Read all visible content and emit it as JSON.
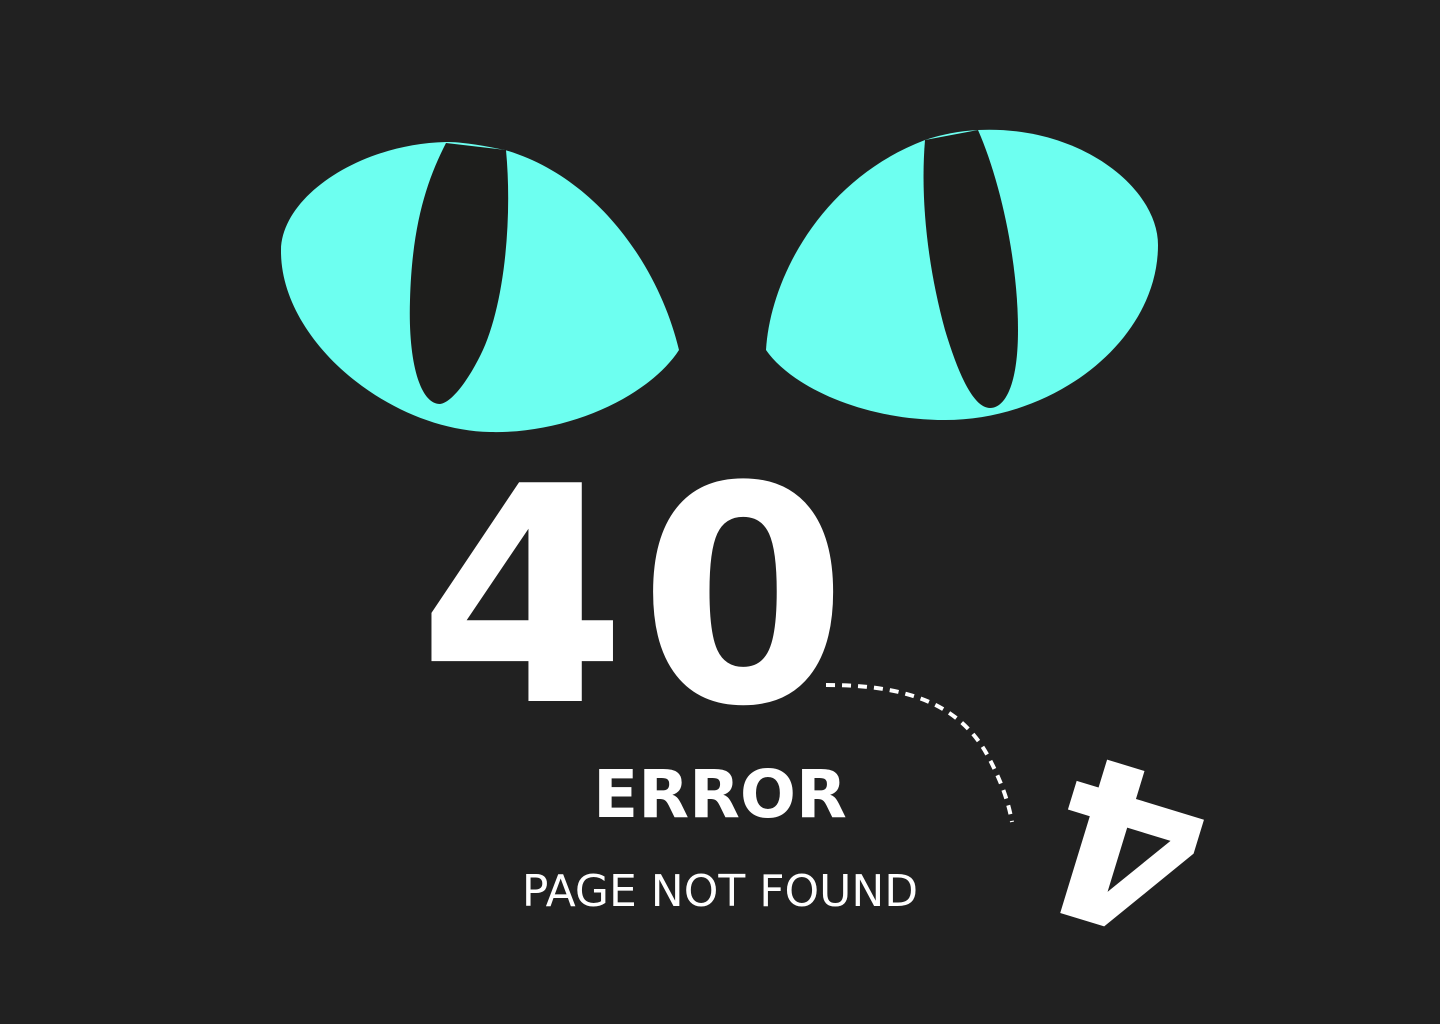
{
  "page": {
    "code_prefix": "40",
    "fallen_digit": "4",
    "title": "ERROR",
    "subtitle": "PAGE NOT FOUND"
  },
  "theme": {
    "background": "#212121",
    "eye_color": "#6dfff0",
    "pupil_color": "#1e1e1c",
    "text_color": "#ffffff"
  }
}
